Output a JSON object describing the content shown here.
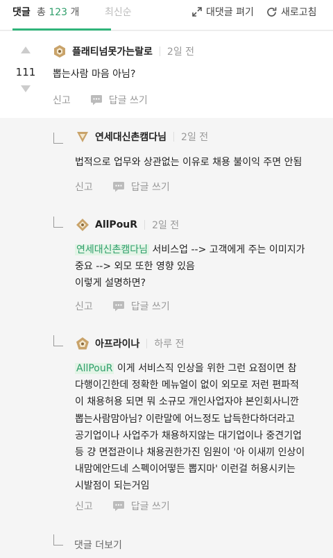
{
  "header": {
    "tab_comments": "댓글",
    "tab_total_prefix": "총",
    "tab_total_count": "123",
    "tab_total_suffix": "개",
    "tab_latest": "최신순",
    "expand_label": "대댓글 펴기",
    "refresh_label": "새로고침"
  },
  "comment": {
    "author": "플래티넘못가는랄로",
    "time": "2일 전",
    "votes": "111",
    "text": "뽑는사람 마음 아님?",
    "report_label": "신고",
    "reply_label": "답글 쓰기"
  },
  "replies": [
    {
      "author": "연세대신촌캠다님",
      "time": "2일 전",
      "mention": "",
      "lines": [
        "법적으로 업무와 상관없는 이유로 채용 불이익 주면 안됨"
      ],
      "report_label": "신고",
      "reply_label": "답글 쓰기"
    },
    {
      "author": "AllPouR",
      "time": "2일 전",
      "mention": "연세대신촌캠다님",
      "lines": [
        "서비스업 --> 고객에게 주는 이미지가",
        "중요 --> 외모 또한 영향 있음",
        "이렇게 설명하면?"
      ],
      "report_label": "신고",
      "reply_label": "답글 쓰기"
    },
    {
      "author": "아프라이나",
      "time": "하루 전",
      "mention": "AllPouR",
      "lines": [
        "이게 서비스직 인상을 위한 그런 요점이면 참",
        "다행이긴한데 정확한 메뉴얼이 없이 외모로 저런 편파적",
        "이 채용허용 되면 뭐 소규모 개인사업자야 본인회사니깐",
        "뽑는사람맘아님? 이란말에 어느정도 납득한다하더라고",
        "공기업이나 사업주가 채용하지않는 대기업이나 중견기업",
        "등 걍 면접관이나 채용권한가진 임원이 '아 이새끼 인상이",
        "내맘에안드네 스펙이어떻든 뽑지마' 이런걸 허용시키는",
        "시발점이 되는거임"
      ],
      "report_label": "신고",
      "reply_label": "답글 쓰기"
    }
  ],
  "more_replies": "댓글 더보기",
  "colors": {
    "accent": "#2fb47a",
    "mention_bg": "#e3f4e6",
    "mention_text": "#2e9e6a"
  }
}
